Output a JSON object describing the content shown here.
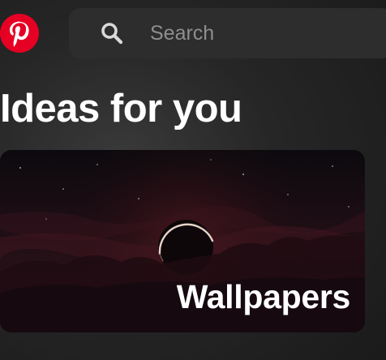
{
  "header": {
    "logo_icon": "pinterest-logo-icon",
    "brand_color": "#e60023",
    "search": {
      "icon": "search-icon",
      "placeholder": "Search",
      "value": ""
    }
  },
  "main": {
    "title": "Ideas for you",
    "cards": [
      {
        "label": "Wallpapers",
        "image": "night-sky-eclipse-wallpaper"
      }
    ]
  }
}
